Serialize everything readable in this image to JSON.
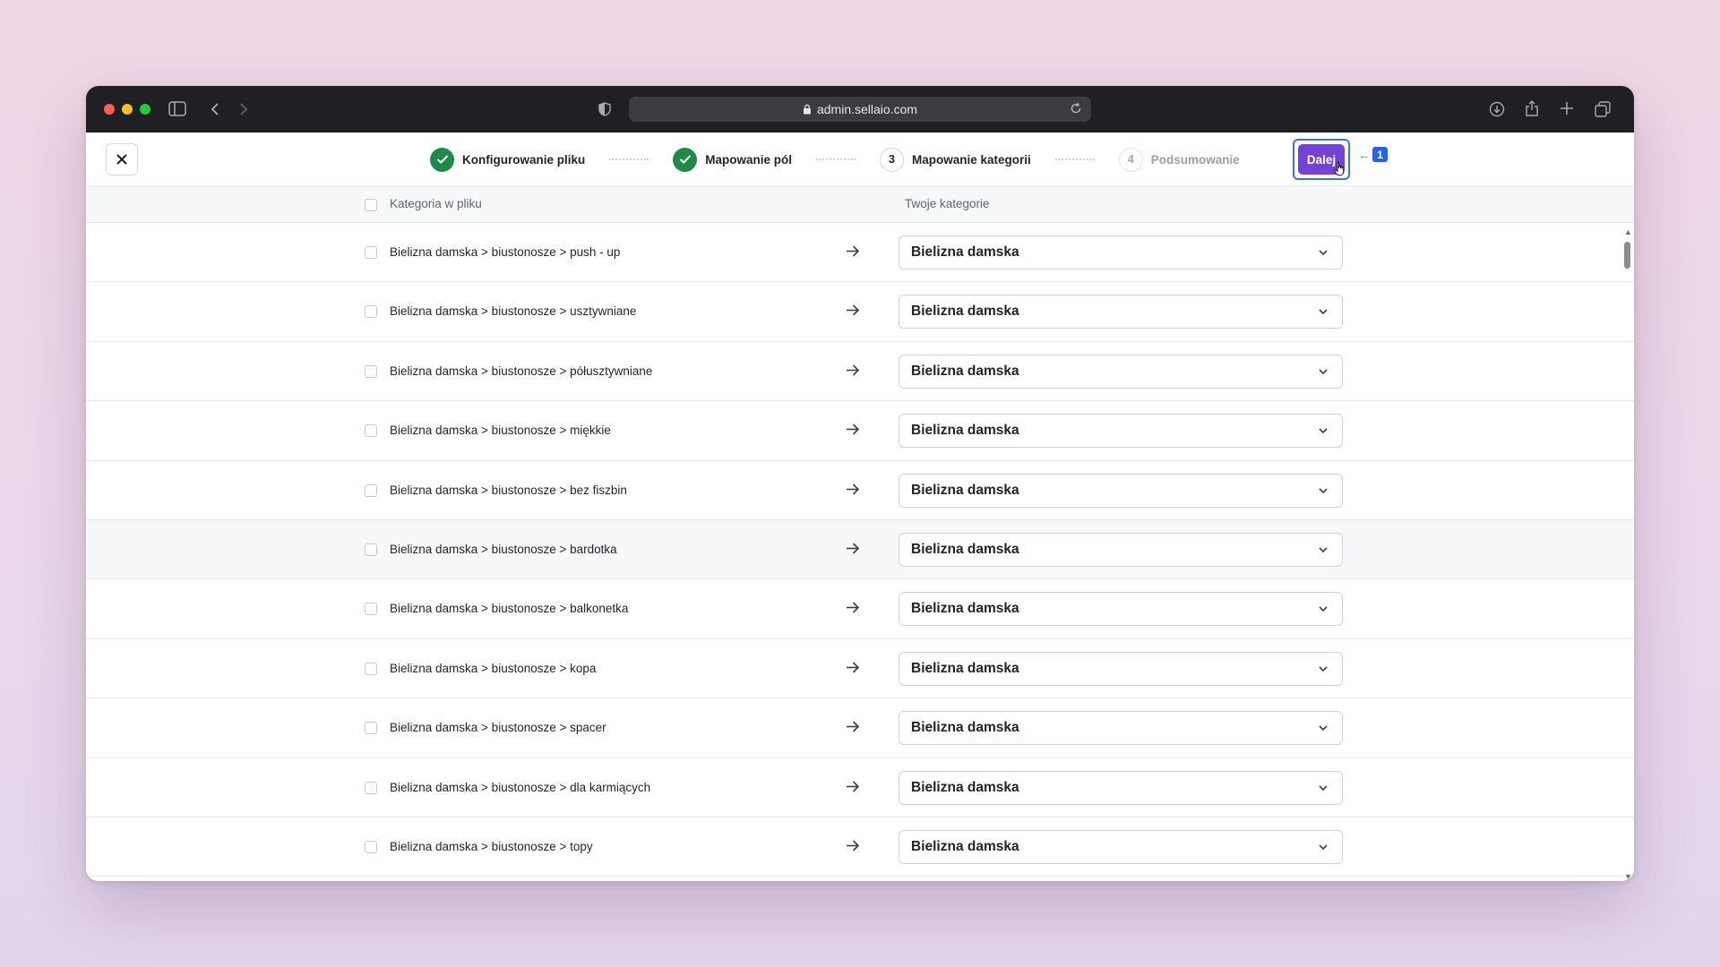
{
  "browser": {
    "url": "admin.sellaio.com"
  },
  "header": {
    "steps": [
      {
        "label": "Konfigurowanie pliku",
        "state": "done"
      },
      {
        "label": "Mapowanie pól",
        "state": "done"
      },
      {
        "label": "Mapowanie kategorii",
        "state": "current",
        "number": "3"
      },
      {
        "label": "Podsumowanie",
        "state": "pending",
        "number": "4"
      }
    ],
    "next_label": "Dalej",
    "marker_number": "1"
  },
  "table": {
    "col_source": "Kategoria w pliku",
    "col_target": "Twoje kategorie",
    "rows": [
      {
        "source": "Bielizna damska > biustonosze > push - up",
        "target": "Bielizna damska"
      },
      {
        "source": "Bielizna damska > biustonosze > usztywniane",
        "target": "Bielizna damska"
      },
      {
        "source": "Bielizna damska > biustonosze > półusztywniane",
        "target": "Bielizna damska"
      },
      {
        "source": "Bielizna damska > biustonosze > miękkie",
        "target": "Bielizna damska"
      },
      {
        "source": "Bielizna damska > biustonosze > bez fiszbin",
        "target": "Bielizna damska"
      },
      {
        "source": "Bielizna damska > biustonosze > bardotka",
        "target": "Bielizna damska"
      },
      {
        "source": "Bielizna damska > biustonosze > balkonetka",
        "target": "Bielizna damska"
      },
      {
        "source": "Bielizna damska > biustonosze > kopa",
        "target": "Bielizna damska"
      },
      {
        "source": "Bielizna damska > biustonosze > spacer",
        "target": "Bielizna damska"
      },
      {
        "source": "Bielizna damska > biustonosze > dla karmiących",
        "target": "Bielizna damska"
      },
      {
        "source": "Bielizna damska > biustonosze > topy",
        "target": "Bielizna damska"
      }
    ]
  },
  "colors": {
    "accent": "#7442d4",
    "success": "#1f8a47",
    "focus_ring": "#3e6ff2"
  }
}
